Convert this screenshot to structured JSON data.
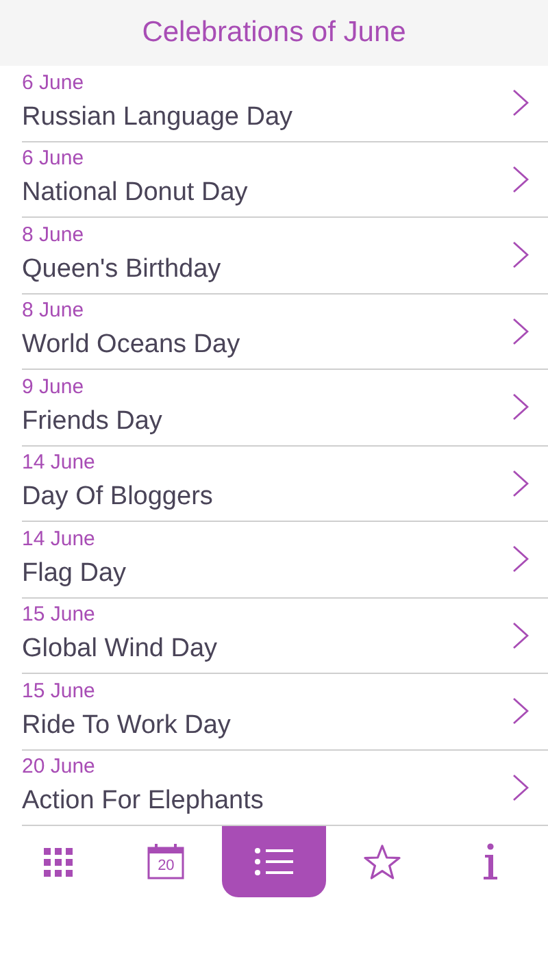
{
  "header": {
    "title": "Celebrations of June"
  },
  "events": [
    {
      "date": "6 June",
      "name": "Russian Language Day"
    },
    {
      "date": "6 June",
      "name": "National Donut Day"
    },
    {
      "date": "8 June",
      "name": "Queen's Birthday"
    },
    {
      "date": "8 June",
      "name": "World Oceans Day"
    },
    {
      "date": "9 June",
      "name": "Friends Day"
    },
    {
      "date": "14 June",
      "name": "Day Of Bloggers"
    },
    {
      "date": "14 June",
      "name": "Flag Day"
    },
    {
      "date": "15 June",
      "name": "Global Wind Day"
    },
    {
      "date": "15 June",
      "name": "Ride To Work Day"
    },
    {
      "date": "20 June",
      "name": "Action For Elephants"
    }
  ],
  "tabs": [
    {
      "kind": "grid",
      "selected": false
    },
    {
      "kind": "calendar",
      "label": "20",
      "selected": false
    },
    {
      "kind": "list",
      "selected": true
    },
    {
      "kind": "star",
      "selected": false
    },
    {
      "kind": "info",
      "selected": false
    }
  ]
}
